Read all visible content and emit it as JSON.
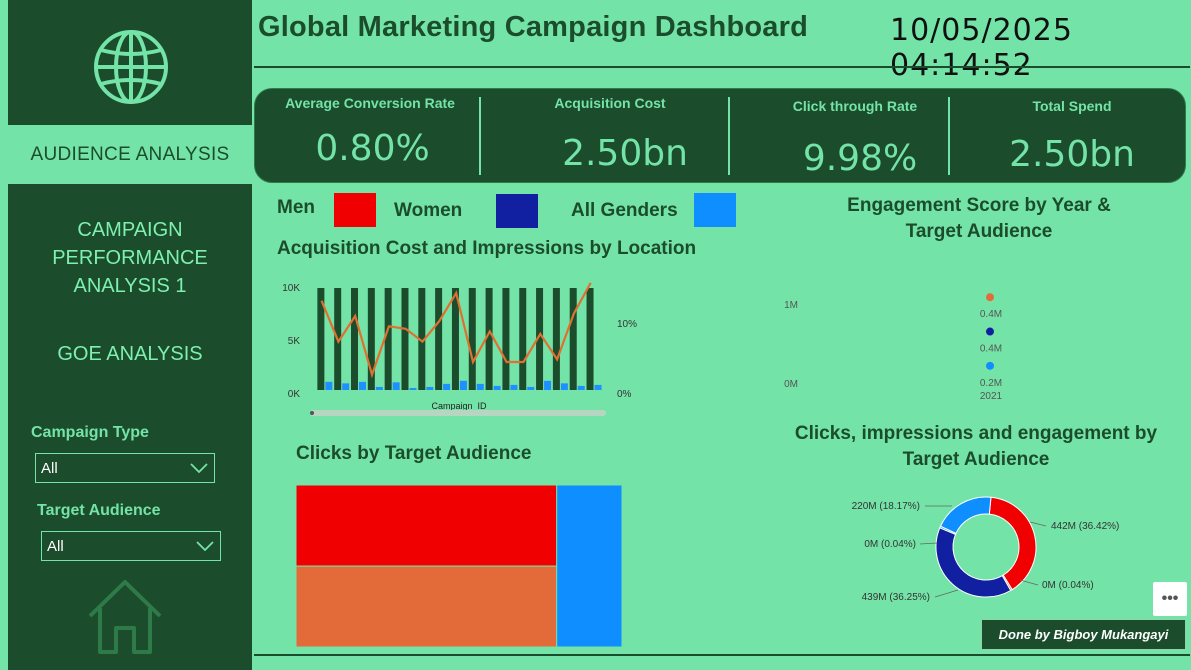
{
  "header": {
    "title": "Global Marketing Campaign Dashboard",
    "datetime": "10/05/2025 04:14:52"
  },
  "sidebar": {
    "items": [
      {
        "label": "AUDIENCE ANALYSIS",
        "active": true
      },
      {
        "label": "CAMPAIGN PERFORMANCE ANALYSIS 1",
        "active": false
      },
      {
        "label": "GOE ANALYSIS",
        "active": false
      }
    ],
    "filters": [
      {
        "label": "Campaign Type",
        "value": "All"
      },
      {
        "label": "Target Audience",
        "value": "All"
      }
    ]
  },
  "kpis": [
    {
      "label": "Average Conversion Rate",
      "value": "0.80%"
    },
    {
      "label": "Acquisition Cost",
      "value": "2.50bn"
    },
    {
      "label": "Click through Rate",
      "value": "9.98%"
    },
    {
      "label": "Total Spend",
      "value": "2.50bn"
    }
  ],
  "legend": [
    {
      "label": "Men",
      "color": "#f00000"
    },
    {
      "label": "Women",
      "color": "#1020a0"
    },
    {
      "label": "All Genders",
      "color": "#0f8fff"
    }
  ],
  "colors": {
    "dark_green": "#1b4d2c",
    "mint": "#74e3a8",
    "line_orange": "#e07030",
    "treemap_orange": "#e36b3a"
  },
  "footer_credit": "Done by Bigboy Mukangayi",
  "more_button": "•••",
  "chart_data": [
    {
      "type": "bar",
      "title": "Acquisition Cost and Impressions by Location",
      "xlabel": "Campaign_ID",
      "y_left_ticks": [
        "10K",
        "5K",
        "0K"
      ],
      "y_right_ticks": [
        "10%",
        "0%"
      ],
      "ylim_left": [
        0,
        10000
      ],
      "ylim_right": [
        0,
        20
      ],
      "categories_count": 17,
      "series": [
        {
          "kind": "bar",
          "color": "#1b4d2c",
          "values": [
            10000,
            10000,
            10000,
            10000,
            10000,
            10000,
            10000,
            10000,
            10000,
            10000,
            10000,
            10000,
            10000,
            10000,
            10000,
            10000,
            10000
          ]
        },
        {
          "kind": "bar",
          "color": "#1e90ff",
          "values": [
            800,
            650,
            800,
            300,
            750,
            200,
            300,
            600,
            900,
            600,
            400,
            500,
            300,
            900,
            650,
            400,
            500
          ]
        },
        {
          "kind": "line",
          "color": "#e07030",
          "axis": "right",
          "values": [
            17.5,
            9.5,
            14.5,
            3.0,
            12.5,
            12.0,
            9.5,
            13.5,
            19.0,
            5.5,
            11.5,
            5.5,
            5.5,
            11.0,
            6.0,
            15.0,
            21.0
          ]
        }
      ]
    },
    {
      "type": "scatter",
      "title": "Engagement Score by Year & Target Audience",
      "y_ticks": [
        "1M",
        "0M"
      ],
      "x_ticks": [
        "2021"
      ],
      "ylim": [
        0,
        1000000
      ],
      "points": [
        {
          "x": "2021",
          "value": 1100000,
          "label": "0.4M",
          "color": "#e36b3a"
        },
        {
          "x": "2021",
          "value": 660000,
          "label": "0.4M",
          "color": "#1020a0"
        },
        {
          "x": "2021",
          "value": 220000,
          "label": "0.2M",
          "color": "#0f8fff"
        }
      ]
    },
    {
      "type": "treemap",
      "title": "Clicks by Target Audience",
      "nodes": [
        {
          "value": 36.4,
          "color": "#f00000"
        },
        {
          "value": 36.3,
          "color": "#e36b3a"
        },
        {
          "value": 18.2,
          "color": "#0f8fff"
        }
      ]
    },
    {
      "type": "pie",
      "title": "Clicks, impressions and engagement by Target Audience",
      "slices": [
        {
          "label": "442M (36.42%)",
          "value": 36.42,
          "color": "#f00000"
        },
        {
          "label": "0M (0.04%)",
          "value": 0.04,
          "color": "#e36b3a"
        },
        {
          "label": "439M (36.25%)",
          "value": 36.25,
          "color": "#1020a0"
        },
        {
          "label": "0M (0.04%)",
          "value": 0.04,
          "color": "#0f8fff"
        },
        {
          "label": "220M (18.17%)",
          "value": 18.17,
          "color": "#0f8fff"
        }
      ]
    }
  ]
}
